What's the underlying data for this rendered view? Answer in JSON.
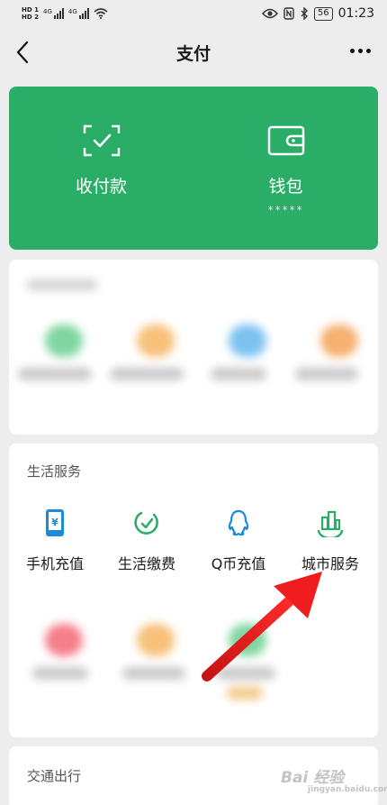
{
  "status_bar": {
    "hd_top": "HD 1",
    "hd_bottom": "HD 2",
    "net1": "4G",
    "net2": "4G",
    "battery": "56",
    "time": "01:23"
  },
  "nav": {
    "title": "支付"
  },
  "wallet_card": {
    "pay_label": "收付款",
    "wallet_label": "钱包",
    "wallet_masked": "*****"
  },
  "life_services": {
    "title": "生活服务",
    "items": [
      {
        "label": "手机充值",
        "icon": "phone-recharge-icon"
      },
      {
        "label": "生活缴费",
        "icon": "bill-payment-icon"
      },
      {
        "label": "Q币充值",
        "icon": "qq-coin-icon"
      },
      {
        "label": "城市服务",
        "icon": "city-service-icon"
      }
    ]
  },
  "transport": {
    "title": "交通出行"
  },
  "watermark": {
    "text": "Bai 经验",
    "sub": "jingyan.baidu.com"
  },
  "colors": {
    "brand_green": "#2aae67",
    "arrow_red": "#e02020",
    "icon_blue": "#1a8bd8"
  }
}
